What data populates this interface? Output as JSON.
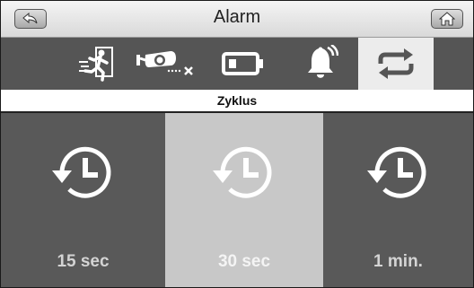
{
  "header": {
    "title": "Alarm",
    "back_icon": "back-arrow-icon",
    "home_icon": "home-icon"
  },
  "tabs": [
    {
      "icon": "running-person-icon",
      "selected": false
    },
    {
      "icon": "camera-disconnected-icon",
      "selected": false
    },
    {
      "icon": "battery-icon",
      "selected": false
    },
    {
      "icon": "bell-ringing-icon",
      "selected": false
    },
    {
      "icon": "cycle-arrows-icon",
      "selected": true
    }
  ],
  "subtitle": "Zyklus",
  "options": [
    {
      "label": "15 sec",
      "icon": "history-clock-icon",
      "selected": false
    },
    {
      "label": "30 sec",
      "icon": "history-clock-icon",
      "selected": true
    },
    {
      "label": "1 min.",
      "icon": "history-clock-icon",
      "selected": false
    }
  ],
  "colors": {
    "tabbar": "#555555",
    "selected_tab": "#ececec",
    "option": "#595959",
    "selected_option": "#c8c8c8"
  }
}
